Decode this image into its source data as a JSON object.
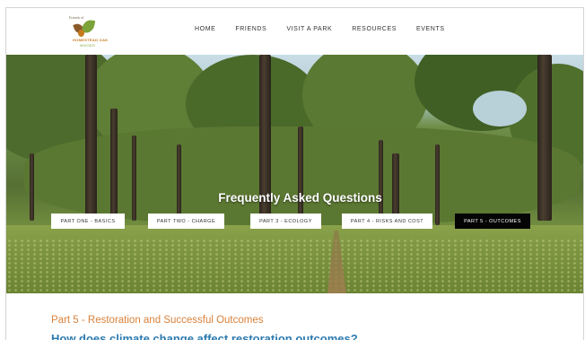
{
  "logo": {
    "line1": "Friends of",
    "line2": "HOMESTEAD OAK",
    "line3": "WOODS"
  },
  "nav": [
    "HOME",
    "FRIENDS",
    "VISIT A PARK",
    "RESOURCES",
    "EVENTS"
  ],
  "hero": {
    "title": "Frequently Asked Questions"
  },
  "tabs": [
    {
      "label": "PART ONE - BASICS",
      "active": false
    },
    {
      "label": "PART TWO - CHARGE",
      "active": false
    },
    {
      "label": "PART 3 - ECOLOGY",
      "active": false
    },
    {
      "label": "PART 4 - RISKS AND COST",
      "active": false
    },
    {
      "label": "PART 5 - OUTCOMES",
      "active": true
    }
  ],
  "content": {
    "part_heading": "Part 5 - Restoration and Successful Outcomes",
    "question": "How does climate change affect restoration outcomes?"
  },
  "colors": {
    "part_heading": "#d9823b",
    "question": "#2c7ab0",
    "active_tab": "#050505"
  }
}
